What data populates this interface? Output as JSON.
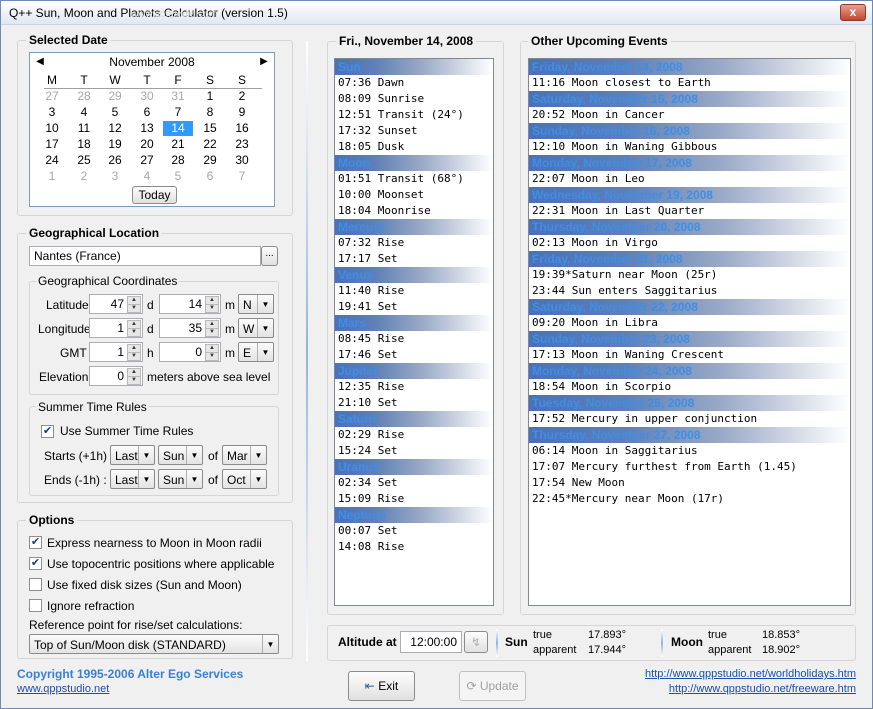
{
  "window": {
    "title": "Q++ Sun, Moon and Planets Calculator (version 1.5)",
    "watermark": "www.softpedia.com",
    "close": "x"
  },
  "selected_date": {
    "title": "Selected Date",
    "month": "November 2008",
    "dow": [
      "M",
      "T",
      "W",
      "T",
      "F",
      "S",
      "S"
    ],
    "weeks": [
      [
        "27",
        "28",
        "29",
        "30",
        "31",
        "1",
        "2"
      ],
      [
        "3",
        "4",
        "5",
        "6",
        "7",
        "8",
        "9"
      ],
      [
        "10",
        "11",
        "12",
        "13",
        "14",
        "15",
        "16"
      ],
      [
        "17",
        "18",
        "19",
        "20",
        "21",
        "22",
        "23"
      ],
      [
        "24",
        "25",
        "26",
        "27",
        "28",
        "29",
        "30"
      ],
      [
        "1",
        "2",
        "3",
        "4",
        "5",
        "6",
        "7"
      ]
    ],
    "selected_day": "14",
    "today_label": "Today"
  },
  "geo": {
    "title": "Geographical Location",
    "location": "Nantes (France)",
    "browse": "...",
    "coords_title": "Geographical Coordinates",
    "latitude_label": "Latitude",
    "lat_deg": "47",
    "lat_min": "14",
    "lat_dir": "N",
    "longitude_label": "Longitude",
    "lon_deg": "1",
    "lon_min": "35",
    "lon_dir": "W",
    "gmt_label": "GMT",
    "gmt_h": "1",
    "gmt_m": "0",
    "gmt_dir": "E",
    "elevation_label": "Elevation",
    "elevation": "0",
    "elevation_unit": "meters above sea level",
    "unit_d": "d",
    "unit_m": "m",
    "unit_h": "h"
  },
  "summer": {
    "title": "Summer Time Rules",
    "use_label": "Use Summer Time Rules",
    "starts_label": "Starts (+1h) :",
    "starts_week": "Last",
    "starts_day": "Sun",
    "of": "of",
    "starts_month": "Mar",
    "ends_label": "Ends (-1h) :",
    "ends_week": "Last",
    "ends_day": "Sun",
    "ends_month": "Oct"
  },
  "options": {
    "title": "Options",
    "items": [
      {
        "label": "Express nearness to Moon in Moon radii",
        "checked": true
      },
      {
        "label": "Use topocentric positions where applicable",
        "checked": true
      },
      {
        "label": "Use fixed disk sizes (Sun and Moon)",
        "checked": false
      },
      {
        "label": "Ignore refraction",
        "checked": false
      }
    ],
    "ref_label": "Reference point for rise/set calculations:",
    "ref_value": "Top of Sun/Moon disk (STANDARD)"
  },
  "day_panel": {
    "title": "Fri., November 14, 2008",
    "sections": [
      {
        "name": "Sun",
        "rows": [
          "07:36 Dawn",
          "08:09 Sunrise",
          "12:51 Transit (24°)",
          "17:32 Sunset",
          "18:05 Dusk"
        ]
      },
      {
        "name": "Moon",
        "rows": [
          "01:51 Transit (68°)",
          "10:00 Moonset",
          "18:04 Moonrise"
        ]
      },
      {
        "name": "Mercury",
        "rows": [
          "07:32 Rise",
          "17:17 Set"
        ]
      },
      {
        "name": "Venus",
        "rows": [
          "11:40 Rise",
          "19:41 Set"
        ]
      },
      {
        "name": "Mars",
        "rows": [
          "08:45 Rise",
          "17:46 Set"
        ]
      },
      {
        "name": "Jupiter",
        "rows": [
          "12:35 Rise",
          "21:10 Set"
        ]
      },
      {
        "name": "Saturn",
        "rows": [
          "02:29 Rise",
          "15:24 Set"
        ]
      },
      {
        "name": "Uranus",
        "rows": [
          "02:34 Set",
          "15:09 Rise"
        ]
      },
      {
        "name": "Neptune",
        "rows": [
          "00:07 Set",
          "14:08 Rise"
        ]
      }
    ]
  },
  "events_panel": {
    "title": "Other Upcoming Events",
    "days": [
      {
        "date": "Friday, November 14, 2008",
        "rows": [
          "11:16 Moon closest to Earth"
        ]
      },
      {
        "date": "Saturday, November 15, 2008",
        "rows": [
          "20:52 Moon in Cancer"
        ]
      },
      {
        "date": "Sunday, November 16, 2008",
        "rows": [
          "12:10 Moon in Waning Gibbous"
        ]
      },
      {
        "date": "Monday, November 17, 2008",
        "rows": [
          "22:07 Moon in Leo"
        ]
      },
      {
        "date": "Wednesday, November 19, 2008",
        "rows": [
          "22:31 Moon in Last Quarter"
        ]
      },
      {
        "date": "Thursday, November 20, 2008",
        "rows": [
          "02:13 Moon in Virgo"
        ]
      },
      {
        "date": "Friday, November 21, 2008",
        "rows": [
          "19:39*Saturn near Moon (25r)",
          "23:44 Sun enters Saggitarius"
        ]
      },
      {
        "date": "Saturday, November 22, 2008",
        "rows": [
          "09:20 Moon in Libra"
        ]
      },
      {
        "date": "Sunday, November 23, 2008",
        "rows": [
          "17:13 Moon in Waning Crescent"
        ]
      },
      {
        "date": "Monday, November 24, 2008",
        "rows": [
          "18:54 Moon in Scorpio"
        ]
      },
      {
        "date": "Tuesday, November 25, 2008",
        "rows": [
          "17:52 Mercury in upper conjunction"
        ]
      },
      {
        "date": "Thursday, November 27, 2008",
        "rows": [
          "06:14 Moon in Saggitarius",
          "17:07 Mercury furthest from Earth (1.45)",
          "17:54 New Moon",
          "22:45*Mercury near Moon (17r)"
        ]
      }
    ]
  },
  "altitude": {
    "label": "Altitude at",
    "time": "12:00:00",
    "sun_label": "Sun",
    "sun_true_label": "true",
    "sun_true": "17.893°",
    "sun_app_label": "apparent",
    "sun_app": "17.944°",
    "moon_label": "Moon",
    "moon_true_label": "true",
    "moon_true": "18.853°",
    "moon_app_label": "apparent",
    "moon_app": "18.902°"
  },
  "footer": {
    "copyright": "Copyright 1995-2006 Alter Ego Services",
    "site": "www.qppstudio.net",
    "exit": "Exit",
    "update": "Update",
    "link1": "http://www.qppstudio.net/worldholidays.htm",
    "link2": "http://www.qppstudio.net/freeware.htm"
  }
}
